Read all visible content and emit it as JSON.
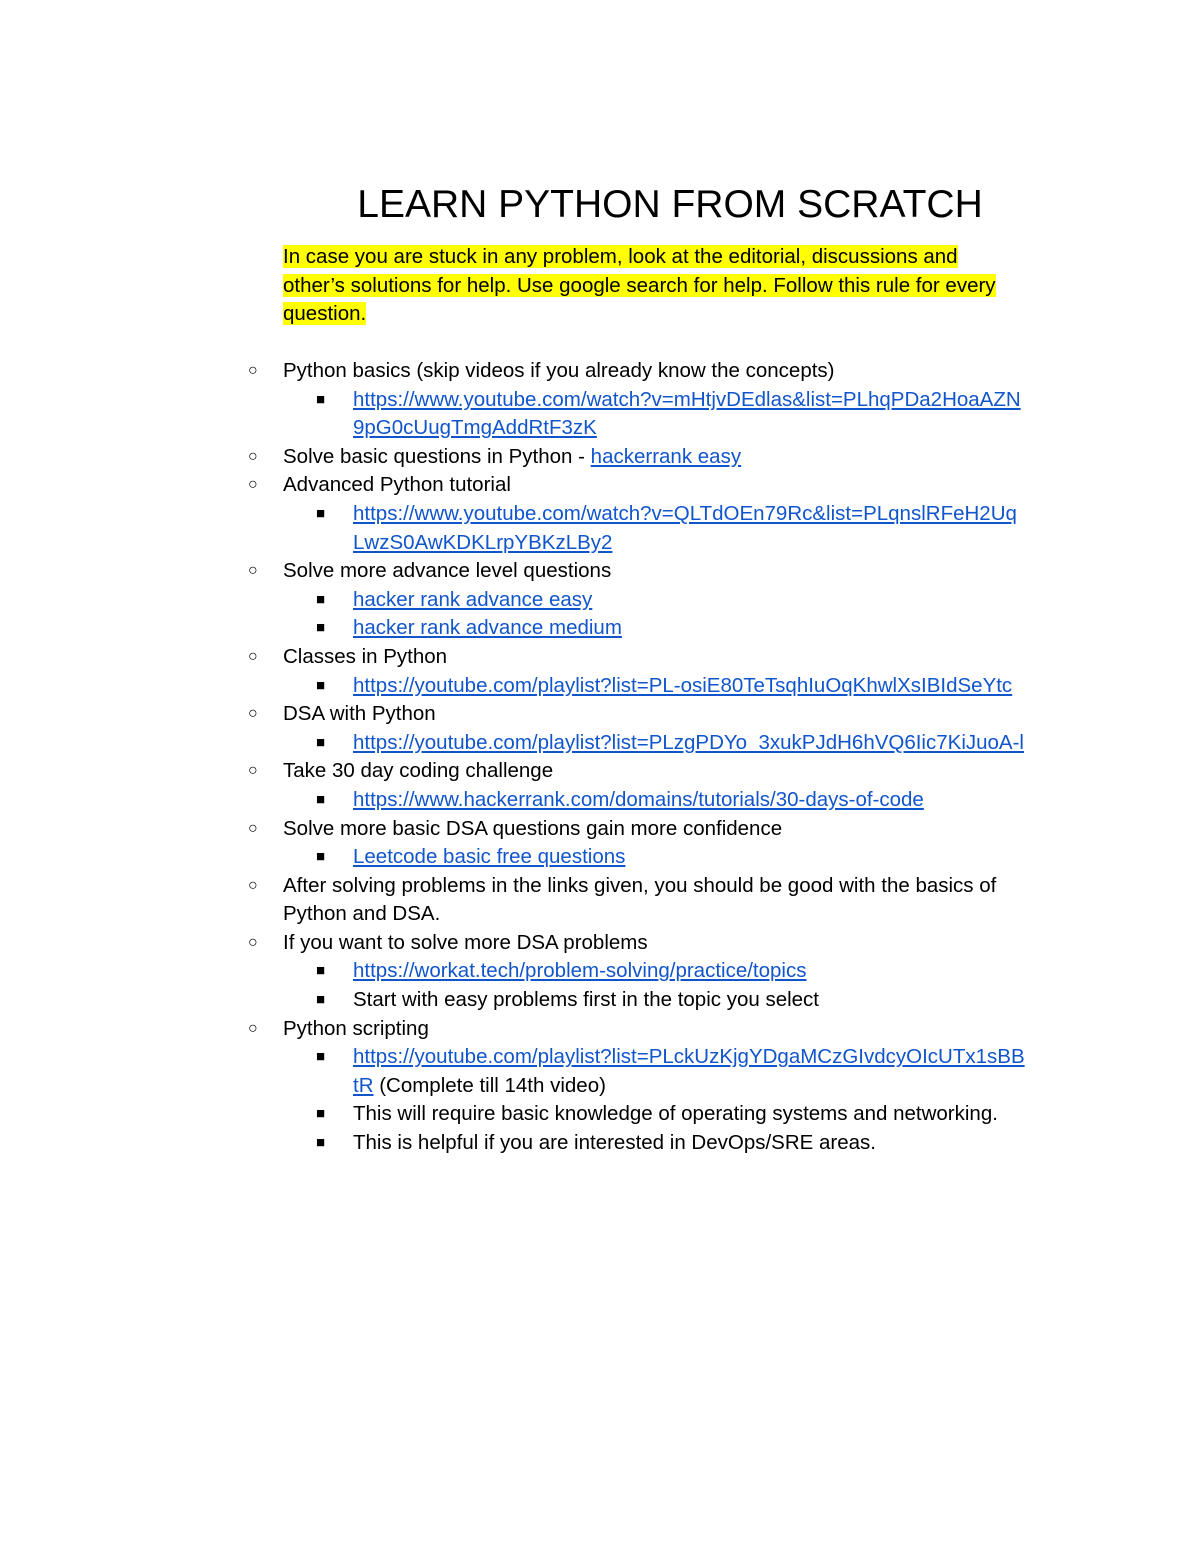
{
  "title": "LEARN PYTHON FROM SCRATCH",
  "note_lines": [
    "In case you are stuck in any problem, look at the editorial, discussions and",
    "other’s solutions for help. Use google search for help. Follow this rule for every",
    "question."
  ],
  "bullets": {
    "level1": "○",
    "level2": "■"
  },
  "items": {
    "python_basics": "Python basics (skip videos if you already know the concepts)",
    "python_basics_link_1": "https://www.youtube.com/watch?v=mHtjvDEdlas&list=PLhqPDa2HoaAZN",
    "python_basics_link_2": "9pG0cUugTmgAddRtF3zK",
    "solve_basic_prefix": "Solve basic questions in Python - ",
    "solve_basic_link": "hackerrank easy",
    "advanced_tutorial": "Advanced Python tutorial",
    "advanced_link_1": "https://www.youtube.com/watch?v=QLTdOEn79Rc&list=PLqnslRFeH2Uq",
    "advanced_link_2": "LwzS0AwKDKLrpYBKzLBy2",
    "solve_advance": "Solve more advance level questions",
    "advance_easy_link": "hacker rank advance easy",
    "advance_medium_link": "hacker rank advance medium",
    "classes": "Classes in Python",
    "classes_link": "https://youtube.com/playlist?list=PL-osiE80TeTsqhIuOqKhwlXsIBIdSeYtc",
    "dsa": "DSA with Python",
    "dsa_link": "https://youtube.com/playlist?list=PLzgPDYo_3xukPJdH6hVQ6Iic7KiJuoA-l",
    "challenge": "Take 30 day coding challenge",
    "challenge_link": "https://www.hackerrank.com/domains/tutorials/30-days-of-code",
    "more_dsa": "Solve more basic DSA questions gain more confidence",
    "leetcode_link": "Leetcode basic free questions",
    "after_1": "After solving problems in the links given, you should be good with the basics of",
    "after_2": "Python and DSA.",
    "more_problems": "If you want to solve more DSA problems",
    "workat_link": "https://workat.tech/problem-solving/practice/topics",
    "easy_first": "Start with easy problems first in the topic you select",
    "scripting": "Python scripting",
    "scripting_link_1": "https://youtube.com/playlist?list=PLckUzKjgYDgaMCzGIvdcyOIcUTx1sBB",
    "scripting_link_2": "tR",
    "scripting_suffix": " (Complete till 14th video)",
    "os_net": "This will require basic knowledge of operating systems and networking.",
    "devops": "This is helpful if you are interested in DevOps/SRE areas."
  },
  "colors": {
    "link": "#1155cc",
    "highlight": "#ffff00"
  }
}
